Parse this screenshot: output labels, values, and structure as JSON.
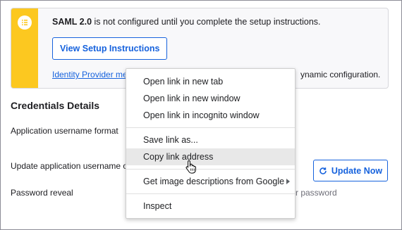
{
  "notice": {
    "icon": "list-icon",
    "bold_text": "SAML 2.0",
    "text": " is not configured until you complete the setup instructions.",
    "setup_button": "View Setup Instructions",
    "metadata_link": "Identity Provider me",
    "metadata_tail": "ynamic configuration.",
    "accent_color": "#fcc820"
  },
  "credentials": {
    "title": "Credentials Details",
    "username_format_label": "Application username format",
    "update_label": "Update application username or",
    "update_button": "Update Now",
    "password_reveal_label": "Password reveal",
    "password_reveal_tail": "r password",
    "link_color": "#1662dd"
  },
  "context_menu": {
    "items": [
      {
        "label": "Open link in new tab"
      },
      {
        "label": "Open link in new window"
      },
      {
        "label": "Open link in incognito window"
      },
      {
        "label": "Save link as..."
      },
      {
        "label": "Copy link address",
        "hovered": true
      },
      {
        "label": "Get image descriptions from Google",
        "submenu": true
      },
      {
        "label": "Inspect"
      }
    ]
  },
  "cursor": {
    "icon": "hand-pointer-icon"
  }
}
